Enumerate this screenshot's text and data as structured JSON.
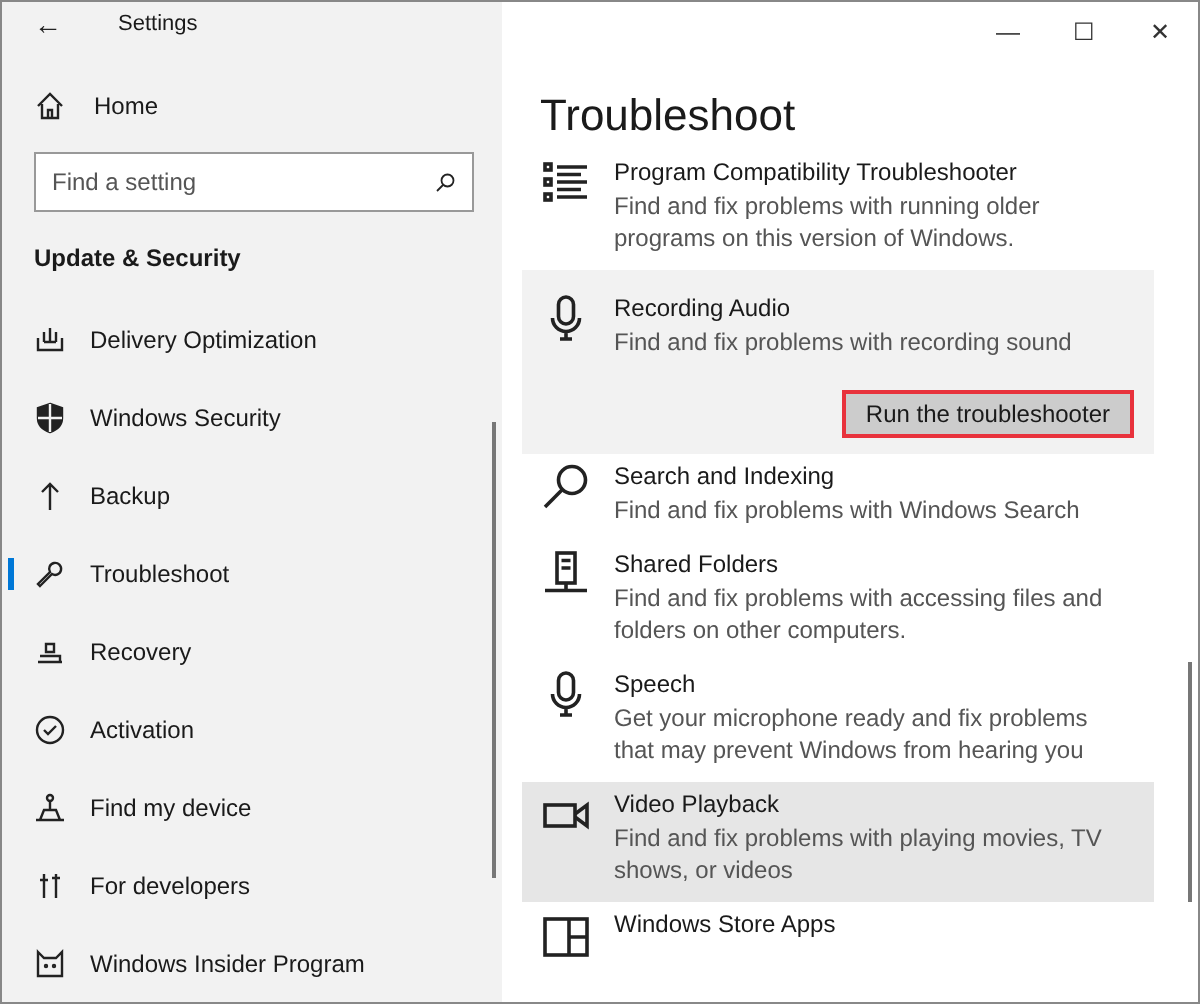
{
  "window": {
    "title": "Settings",
    "back": "←",
    "controls": [
      "—",
      "☐",
      "✕"
    ]
  },
  "sidebar": {
    "home": "Home",
    "search": {
      "placeholder": "Find a setting"
    },
    "section": "Update & Security",
    "items": [
      {
        "label": "Delivery Optimization",
        "selected": false
      },
      {
        "label": "Windows Security",
        "selected": false
      },
      {
        "label": "Backup",
        "selected": false
      },
      {
        "label": "Troubleshoot",
        "selected": true
      },
      {
        "label": "Recovery",
        "selected": false
      },
      {
        "label": "Activation",
        "selected": false
      },
      {
        "label": "Find my device",
        "selected": false
      },
      {
        "label": "For developers",
        "selected": false
      },
      {
        "label": "Windows Insider Program",
        "selected": false
      }
    ]
  },
  "main": {
    "title": "Troubleshoot",
    "items": [
      {
        "title": "Program Compatibility Troubleshooter",
        "description": "Find and fix problems with running older programs on this version of Windows.",
        "expanded": false,
        "hovered": false
      },
      {
        "title": "Recording Audio",
        "description": "Find and fix problems with recording sound",
        "expanded": true,
        "hovered": false,
        "button": "Run the troubleshooter"
      },
      {
        "title": "Search and Indexing",
        "description": "Find and fix problems with Windows Search",
        "expanded": false,
        "hovered": false
      },
      {
        "title": "Shared Folders",
        "description": "Find and fix problems with accessing files and folders on other computers.",
        "expanded": false,
        "hovered": false
      },
      {
        "title": "Speech",
        "description": "Get your microphone ready and fix problems that may prevent Windows from hearing you",
        "expanded": false,
        "hovered": false
      },
      {
        "title": "Video Playback",
        "description": "Find and fix problems with playing movies, TV shows, or videos",
        "expanded": false,
        "hovered": true
      },
      {
        "title": "Windows Store Apps",
        "expanded": false,
        "hovered": false
      }
    ]
  }
}
